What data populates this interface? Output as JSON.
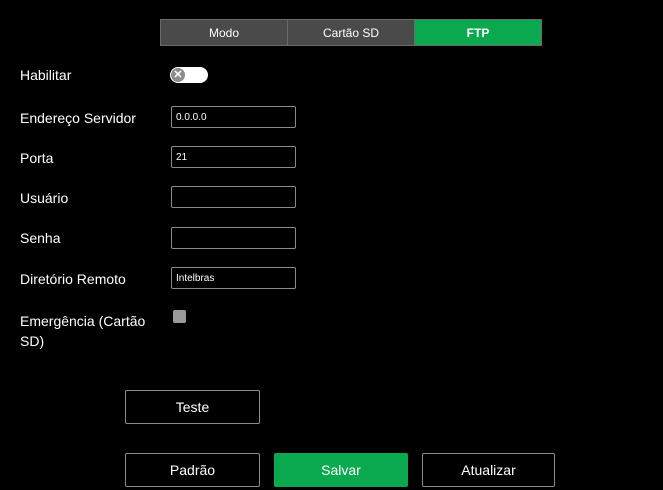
{
  "tabs": [
    {
      "label": "Modo"
    },
    {
      "label": "Cartão SD"
    },
    {
      "label": "FTP"
    }
  ],
  "form": {
    "enable_label": "Habilitar",
    "toggle_icon": "x-icon",
    "toggle_glyph": "✕",
    "server_label": "Endereço Servidor",
    "server_value": "0.0.0.0",
    "port_label": "Porta",
    "port_value": "21",
    "user_label": "Usuário",
    "user_value": "",
    "password_label": "Senha",
    "password_value": "",
    "remote_dir_label": "Diretório Remoto",
    "remote_dir_value": "Intelbras",
    "emergency_label_line1": "Emergência (Cartão",
    "emergency_label_line2": "SD)"
  },
  "buttons": {
    "test": "Teste",
    "default": "Padrão",
    "save": "Salvar",
    "refresh": "Atualizar"
  },
  "colors": {
    "accent": "#0aa84f",
    "background": "#000000",
    "tab_inactive": "#4a4a4a"
  }
}
